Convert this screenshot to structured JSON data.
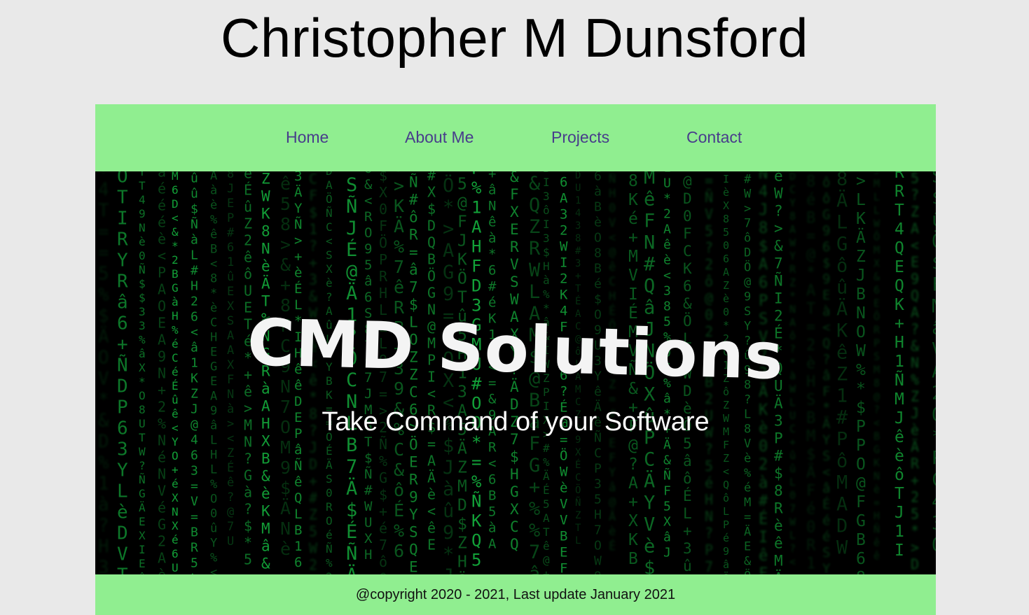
{
  "header": {
    "title": "Christopher M Dunsford"
  },
  "nav": {
    "items": [
      {
        "label": "Home"
      },
      {
        "label": "About Me"
      },
      {
        "label": "Projects"
      },
      {
        "label": "Contact"
      }
    ]
  },
  "hero": {
    "title": "CMD Solutions",
    "subtitle": "Take Command of your Software",
    "background": "matrix-code-rain"
  },
  "footer": {
    "text": "@copyright 2020 - 2021, Last update January 2021"
  },
  "colors": {
    "page_background": "#e9e9e9",
    "nav_background": "#90ee90",
    "nav_link": "#483d8b",
    "hero_background": "#000000",
    "code_green": "#1fbf4a",
    "hero_text": "#f4f4f4"
  }
}
